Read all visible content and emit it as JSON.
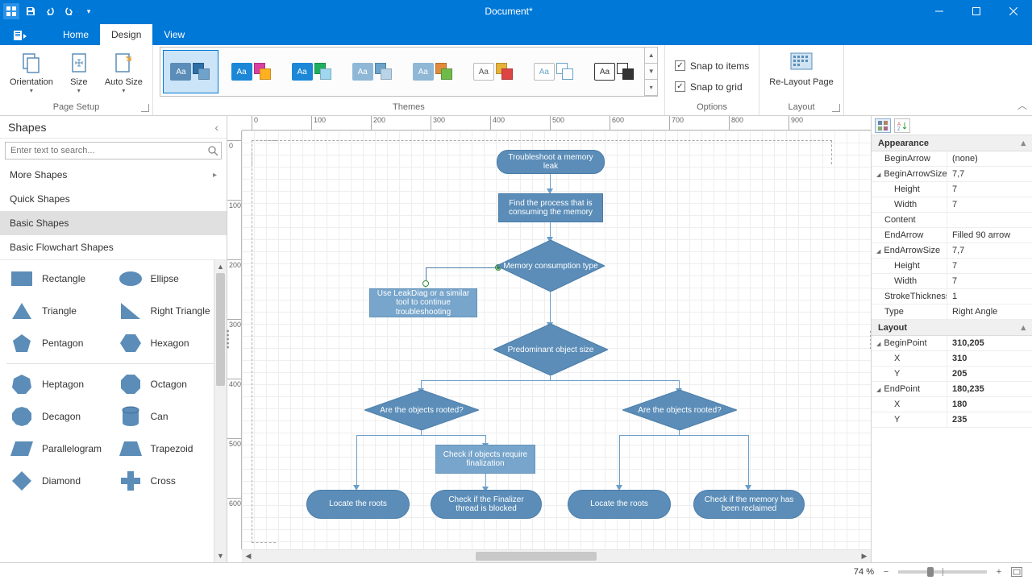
{
  "window": {
    "title": "Document*"
  },
  "tabs": {
    "home": "Home",
    "design": "Design",
    "view": "View"
  },
  "ribbon": {
    "page_setup": {
      "orientation": "Orientation",
      "size": "Size",
      "auto_size": "Auto Size",
      "caption": "Page Setup"
    },
    "themes_caption": "Themes",
    "options": {
      "snap_items": "Snap to items",
      "snap_grid": "Snap to grid",
      "caption": "Options"
    },
    "layout": {
      "relayout": "Re-Layout Page",
      "caption": "Layout"
    }
  },
  "shapes_panel": {
    "title": "Shapes",
    "search_placeholder": "Enter text to search...",
    "cats": {
      "more": "More Shapes",
      "quick": "Quick Shapes",
      "basic": "Basic Shapes",
      "flow": "Basic Flowchart Shapes"
    },
    "items": {
      "rectangle": "Rectangle",
      "ellipse": "Ellipse",
      "triangle": "Triangle",
      "right_triangle": "Right Triangle",
      "pentagon": "Pentagon",
      "hexagon": "Hexagon",
      "heptagon": "Heptagon",
      "octagon": "Octagon",
      "decagon": "Decagon",
      "can": "Can",
      "parallelogram": "Parallelogram",
      "trapezoid": "Trapezoid",
      "diamond": "Diamond",
      "cross": "Cross"
    }
  },
  "flowchart": {
    "n1": "Troubleshoot a memory leak",
    "n2": "Find the process that is consuming the memory",
    "n3": "Memory consumption type",
    "n4": "Use LeakDiag or a similar tool to continue troubleshooting",
    "n5": "Predominant object size",
    "n6": "Are the objects rooted?",
    "n7": "Are the objects rooted?",
    "n8": "Check if objects require finalization",
    "n9": "Locate the roots",
    "n10": "Check if the Finalizer thread is blocked",
    "n11": "Locate the roots",
    "n12": "Check if the memory has been reclaimed"
  },
  "ruler_h": [
    "0",
    "100",
    "200",
    "300",
    "400",
    "500",
    "600",
    "700",
    "800",
    "900"
  ],
  "ruler_v": [
    "0",
    "100",
    "200",
    "300",
    "400",
    "500",
    "600"
  ],
  "properties": {
    "appearance": {
      "label": "Appearance",
      "begin_arrow_k": "BeginArrow",
      "begin_arrow_v": "(none)",
      "begin_arrow_size_k": "BeginArrowSize",
      "begin_arrow_size_v": "7,7",
      "height_k": "Height",
      "height_v": "7",
      "width_k": "Width",
      "width_v": "7",
      "content_k": "Content",
      "content_v": "",
      "end_arrow_k": "EndArrow",
      "end_arrow_v": "Filled 90 arrow",
      "end_arrow_size_k": "EndArrowSize",
      "end_arrow_size_v": "7,7",
      "height2_v": "7",
      "width2_v": "7",
      "stroke_k": "StrokeThickness",
      "stroke_v": "1",
      "type_k": "Type",
      "type_v": "Right Angle"
    },
    "layout": {
      "label": "Layout",
      "begin_point_k": "BeginPoint",
      "begin_point_v": "310,205",
      "bx_k": "X",
      "bx_v": "310",
      "by_k": "Y",
      "by_v": "205",
      "end_point_k": "EndPoint",
      "end_point_v": "180,235",
      "ex_k": "X",
      "ex_v": "180",
      "ey_k": "Y",
      "ey_v": "235"
    }
  },
  "status": {
    "zoom": "74 %"
  }
}
